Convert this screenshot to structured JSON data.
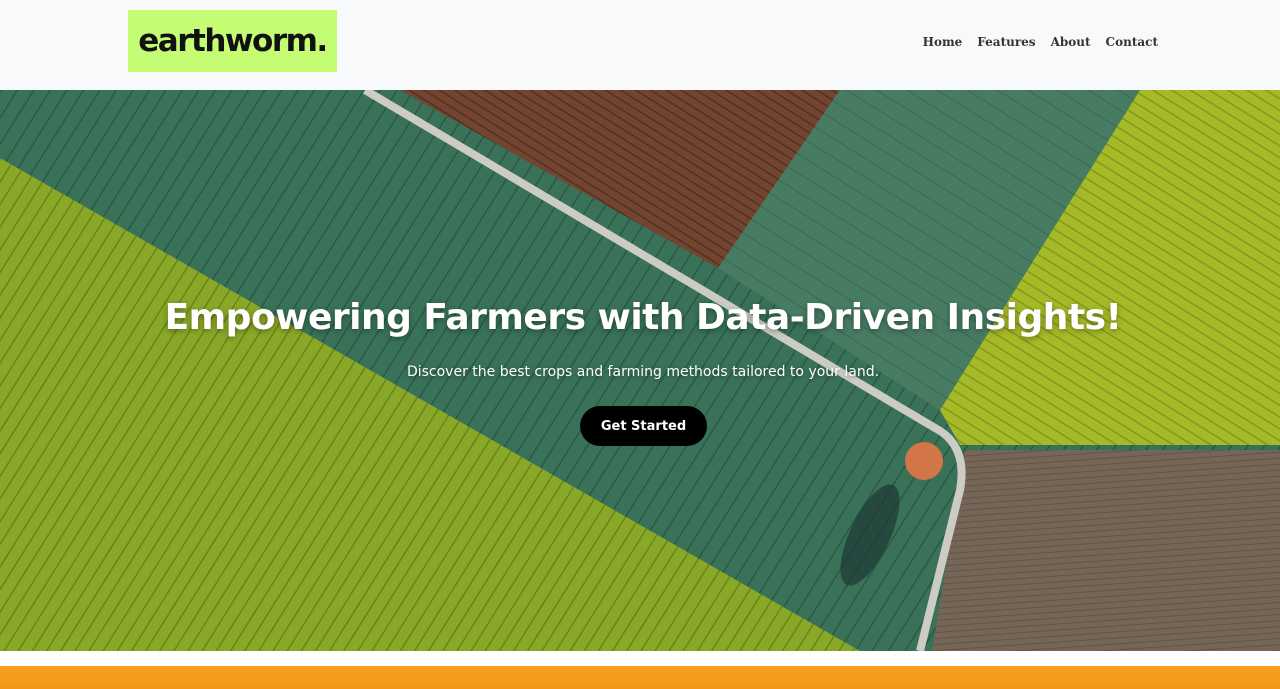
{
  "header": {
    "logo_text": "earthworm.",
    "logo_color": "#c4fc74",
    "nav": [
      {
        "label": "Home"
      },
      {
        "label": "Features"
      },
      {
        "label": "About"
      },
      {
        "label": "Contact"
      }
    ]
  },
  "hero": {
    "title": "Empowering Farmers with Data-Driven Insights!",
    "subtitle": "Discover the best crops and farming methods tailored to your land.",
    "cta_label": "Get Started"
  },
  "colors": {
    "accent": "#c4fc74",
    "cta_bg": "#000000",
    "section_orange": "#f7a21b"
  }
}
